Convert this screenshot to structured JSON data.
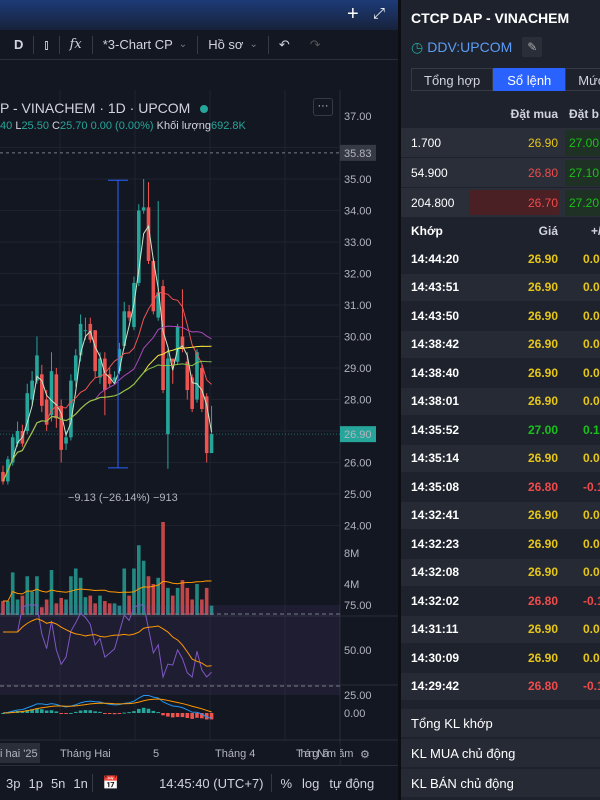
{
  "toolbar": {
    "interval": "D",
    "layout": "*3-Chart CP",
    "profile": "Hồ sơ"
  },
  "chart": {
    "title": "P - VINACHEM · 1D · UPCOM",
    "ohlc": {
      "o_tail": "40",
      "l_label": "L",
      "l": "25.50",
      "c_label": "C",
      "c": "25.70",
      "change": "0.00 (0.00%)",
      "vol_label": "Khối lượng",
      "vol": "692.8K"
    },
    "measure_label": "−9.13 (−26.14%) −913",
    "price_ticks": [
      "37.00",
      "35.00",
      "34.00",
      "33.00",
      "32.00",
      "31.00",
      "30.00",
      "29.00",
      "28.00",
      "27.00",
      "26.00",
      "25.00",
      "24.00"
    ],
    "high_marker": "35.83",
    "last_price": "26.90",
    "vol_ticks": [
      "8M",
      "4M"
    ],
    "rsi_ticks": [
      "75.00",
      "50.00",
      "25.00"
    ],
    "macd_ticks": [
      "0.00"
    ],
    "time_ticks": [
      "i hai '25",
      "Tháng Hai",
      "5",
      "Tháng 4",
      "Tháng Năm"
    ],
    "colors": {
      "up": "#26a69a",
      "down": "#ef5350",
      "accent": "#2962ff"
    }
  },
  "chart_data": {
    "type": "candlestick",
    "ylim": [
      24,
      37.5
    ],
    "candles": [
      [
        25.7,
        25.9,
        25.3,
        25.4
      ],
      [
        25.4,
        26.2,
        25.3,
        26.1
      ],
      [
        26.0,
        26.9,
        25.9,
        26.8
      ],
      [
        26.6,
        27.3,
        26.5,
        27.0
      ],
      [
        27.0,
        27.2,
        26.5,
        26.6
      ],
      [
        27.0,
        28.5,
        26.9,
        28.2
      ],
      [
        28.0,
        28.9,
        27.8,
        28.6
      ],
      [
        28.6,
        30.0,
        28.5,
        29.4
      ],
      [
        28.8,
        29.1,
        27.6,
        27.8
      ],
      [
        28.0,
        28.3,
        27.0,
        27.2
      ],
      [
        27.5,
        29.5,
        27.3,
        28.9
      ],
      [
        28.8,
        29.0,
        27.1,
        27.4
      ],
      [
        27.8,
        28.0,
        26.0,
        26.4
      ],
      [
        26.6,
        27.0,
        26.4,
        26.8
      ],
      [
        26.8,
        28.8,
        26.7,
        28.6
      ],
      [
        28.6,
        29.6,
        28.4,
        29.4
      ],
      [
        29.4,
        30.7,
        29.2,
        30.4
      ],
      [
        30.2,
        30.6,
        29.9,
        30.2
      ],
      [
        30.4,
        30.6,
        29.8,
        29.9
      ],
      [
        30.2,
        30.2,
        28.7,
        28.9
      ],
      [
        28.7,
        29.5,
        28.5,
        29.3
      ],
      [
        29.3,
        29.5,
        27.5,
        28.3
      ],
      [
        28.8,
        29.0,
        28.4,
        28.5
      ],
      [
        28.6,
        28.9,
        28.5,
        28.7
      ],
      [
        28.9,
        29.8,
        28.8,
        29.6
      ],
      [
        29.7,
        31.1,
        29.6,
        30.8
      ],
      [
        30.8,
        31.0,
        30.5,
        30.6
      ],
      [
        30.3,
        31.9,
        30.2,
        31.7
      ],
      [
        31.7,
        34.2,
        31.6,
        34.0
      ],
      [
        34.0,
        35.0,
        33.9,
        34.1
      ],
      [
        34.1,
        34.9,
        32.3,
        32.4
      ],
      [
        32.4,
        32.5,
        30.7,
        30.8
      ],
      [
        30.6,
        34.3,
        30.5,
        31.4
      ],
      [
        31.6,
        31.8,
        28.2,
        28.3
      ],
      [
        26.9,
        29.6,
        25.8,
        29.3
      ],
      [
        29.3,
        29.3,
        28.5,
        29.2
      ],
      [
        29.2,
        30.4,
        29.1,
        30.3
      ],
      [
        30.0,
        31.5,
        29.5,
        29.6
      ],
      [
        29.2,
        29.5,
        28.0,
        28.3
      ],
      [
        28.7,
        28.8,
        27.6,
        27.7
      ],
      [
        28.0,
        29.6,
        27.9,
        29.5
      ],
      [
        29.0,
        29.1,
        27.6,
        27.7
      ],
      [
        28.1,
        28.2,
        26.0,
        26.3
      ],
      [
        26.3,
        27.8,
        26.5,
        26.9
      ]
    ],
    "volume_m": [
      1.8,
      1.8,
      5.5,
      2.0,
      2.5,
      5.0,
      3.0,
      5.0,
      1.0,
      2.0,
      5.8,
      1.5,
      2.2,
      2.0,
      5.0,
      6.0,
      4.8,
      2.3,
      2.5,
      1.5,
      2.5,
      1.8,
      1.5,
      1.5,
      1.2,
      6.0,
      2.5,
      6.0,
      9.0,
      7.0,
      5.0,
      4.0,
      4.8,
      12.0,
      3.5,
      2.5,
      3.5,
      4.5,
      3.5,
      2.0,
      4.0,
      2.0,
      3.5,
      1.2
    ],
    "measure": {
      "from": 34.96,
      "to": 25.83
    }
  },
  "bottom": {
    "ranges": [
      "3p",
      "1p",
      "5n",
      "1n"
    ],
    "clock": "14:45:40 (UTC+7)",
    "pct": "%",
    "log": "log",
    "auto": "tự động"
  },
  "panel": {
    "title": "CTCP DAP - VINACHEM",
    "symbol": "DDV:UPCOM",
    "tabs": [
      "Tổng hợp",
      "Sổ lệnh",
      "Mức"
    ],
    "book_headers": [
      "Đặt mua",
      "Đặt b"
    ],
    "book": [
      {
        "vol": "1.700",
        "bid": "26.90",
        "bid_c": "yel",
        "ask": "27.00"
      },
      {
        "vol": "54.900",
        "bid": "26.80",
        "bid_c": "red",
        "ask": "27.10"
      },
      {
        "vol": "204.800",
        "bid": "26.70",
        "bid_c": "red",
        "ask": "27.20"
      }
    ],
    "trade_headers": [
      "Khớp",
      "Giá",
      "+/"
    ],
    "trades": [
      [
        "14:44:20",
        "26.90",
        "0.0",
        "yel"
      ],
      [
        "14:43:51",
        "26.90",
        "0.0",
        "yel"
      ],
      [
        "14:43:50",
        "26.90",
        "0.0",
        "yel"
      ],
      [
        "14:38:42",
        "26.90",
        "0.0",
        "yel"
      ],
      [
        "14:38:40",
        "26.90",
        "0.0",
        "yel"
      ],
      [
        "14:38:01",
        "26.90",
        "0.0",
        "yel"
      ],
      [
        "14:35:52",
        "27.00",
        "0.1",
        "gr"
      ],
      [
        "14:35:14",
        "26.90",
        "0.0",
        "yel"
      ],
      [
        "14:35:08",
        "26.80",
        "-0.1",
        "red"
      ],
      [
        "14:32:41",
        "26.90",
        "0.0",
        "yel"
      ],
      [
        "14:32:23",
        "26.90",
        "0.0",
        "yel"
      ],
      [
        "14:32:08",
        "26.90",
        "0.0",
        "yel"
      ],
      [
        "14:32:02",
        "26.80",
        "-0.1",
        "red"
      ],
      [
        "14:31:11",
        "26.90",
        "0.0",
        "yel"
      ],
      [
        "14:30:09",
        "26.90",
        "0.0",
        "yel"
      ],
      [
        "14:29:42",
        "26.80",
        "-0.1",
        "red"
      ]
    ],
    "footer": [
      "Tổng KL khớp",
      "KL MUA chủ động",
      "KL BÁN chủ động"
    ]
  }
}
